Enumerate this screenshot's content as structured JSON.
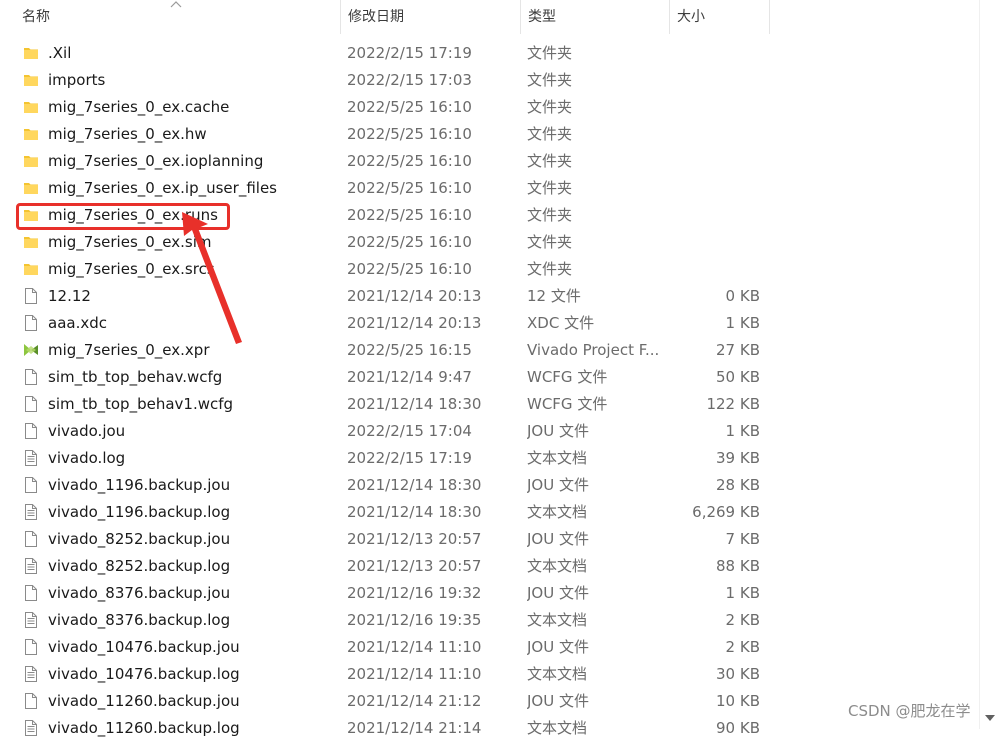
{
  "columns": {
    "name": "名称",
    "date": "修改日期",
    "type": "类型",
    "size": "大小"
  },
  "files": [
    {
      "name": ".Xil",
      "date": "2022/2/15 17:19",
      "type": "文件夹",
      "size": "",
      "icon": "folder-icon"
    },
    {
      "name": "imports",
      "date": "2022/2/15 17:03",
      "type": "文件夹",
      "size": "",
      "icon": "folder-icon"
    },
    {
      "name": "mig_7series_0_ex.cache",
      "date": "2022/5/25 16:10",
      "type": "文件夹",
      "size": "",
      "icon": "folder-icon"
    },
    {
      "name": "mig_7series_0_ex.hw",
      "date": "2022/5/25 16:10",
      "type": "文件夹",
      "size": "",
      "icon": "folder-icon"
    },
    {
      "name": "mig_7series_0_ex.ioplanning",
      "date": "2022/5/25 16:10",
      "type": "文件夹",
      "size": "",
      "icon": "folder-icon"
    },
    {
      "name": "mig_7series_0_ex.ip_user_files",
      "date": "2022/5/25 16:10",
      "type": "文件夹",
      "size": "",
      "icon": "folder-icon"
    },
    {
      "name": "mig_7series_0_ex.runs",
      "date": "2022/5/25 16:10",
      "type": "文件夹",
      "size": "",
      "icon": "folder-icon"
    },
    {
      "name": "mig_7series_0_ex.sim",
      "date": "2022/5/25 16:10",
      "type": "文件夹",
      "size": "",
      "icon": "folder-icon"
    },
    {
      "name": "mig_7series_0_ex.srcs",
      "date": "2022/5/25 16:10",
      "type": "文件夹",
      "size": "",
      "icon": "folder-icon"
    },
    {
      "name": "12.12",
      "date": "2021/12/14 20:13",
      "type": "12 文件",
      "size": "0 KB",
      "icon": "file-icon"
    },
    {
      "name": "aaa.xdc",
      "date": "2021/12/14 20:13",
      "type": "XDC 文件",
      "size": "1 KB",
      "icon": "file-icon"
    },
    {
      "name": "mig_7series_0_ex.xpr",
      "date": "2022/5/25 16:15",
      "type": "Vivado Project F...",
      "size": "27 KB",
      "icon": "vivado-icon"
    },
    {
      "name": "sim_tb_top_behav.wcfg",
      "date": "2021/12/14 9:47",
      "type": "WCFG 文件",
      "size": "50 KB",
      "icon": "file-icon"
    },
    {
      "name": "sim_tb_top_behav1.wcfg",
      "date": "2021/12/14 18:30",
      "type": "WCFG 文件",
      "size": "122 KB",
      "icon": "file-icon"
    },
    {
      "name": "vivado.jou",
      "date": "2022/2/15 17:04",
      "type": "JOU 文件",
      "size": "1 KB",
      "icon": "file-icon"
    },
    {
      "name": "vivado.log",
      "date": "2022/2/15 17:19",
      "type": "文本文档",
      "size": "39 KB",
      "icon": "text-file-icon"
    },
    {
      "name": "vivado_1196.backup.jou",
      "date": "2021/12/14 18:30",
      "type": "JOU 文件",
      "size": "28 KB",
      "icon": "file-icon"
    },
    {
      "name": "vivado_1196.backup.log",
      "date": "2021/12/14 18:30",
      "type": "文本文档",
      "size": "6,269 KB",
      "icon": "text-file-icon"
    },
    {
      "name": "vivado_8252.backup.jou",
      "date": "2021/12/13 20:57",
      "type": "JOU 文件",
      "size": "7 KB",
      "icon": "file-icon"
    },
    {
      "name": "vivado_8252.backup.log",
      "date": "2021/12/13 20:57",
      "type": "文本文档",
      "size": "88 KB",
      "icon": "text-file-icon"
    },
    {
      "name": "vivado_8376.backup.jou",
      "date": "2021/12/16 19:32",
      "type": "JOU 文件",
      "size": "1 KB",
      "icon": "file-icon"
    },
    {
      "name": "vivado_8376.backup.log",
      "date": "2021/12/16 19:35",
      "type": "文本文档",
      "size": "2 KB",
      "icon": "text-file-icon"
    },
    {
      "name": "vivado_10476.backup.jou",
      "date": "2021/12/14 11:10",
      "type": "JOU 文件",
      "size": "2 KB",
      "icon": "file-icon"
    },
    {
      "name": "vivado_10476.backup.log",
      "date": "2021/12/14 11:10",
      "type": "文本文档",
      "size": "30 KB",
      "icon": "text-file-icon"
    },
    {
      "name": "vivado_11260.backup.jou",
      "date": "2021/12/14 21:12",
      "type": "JOU 文件",
      "size": "10 KB",
      "icon": "file-icon"
    },
    {
      "name": "vivado_11260.backup.log",
      "date": "2021/12/14 21:14",
      "type": "文本文档",
      "size": "90 KB",
      "icon": "text-file-icon"
    }
  ],
  "watermark": "CSDN @肥龙在学",
  "colors": {
    "folder": "#f4c430",
    "annotation": "#e8302a",
    "vivado": "#8dc63f"
  }
}
